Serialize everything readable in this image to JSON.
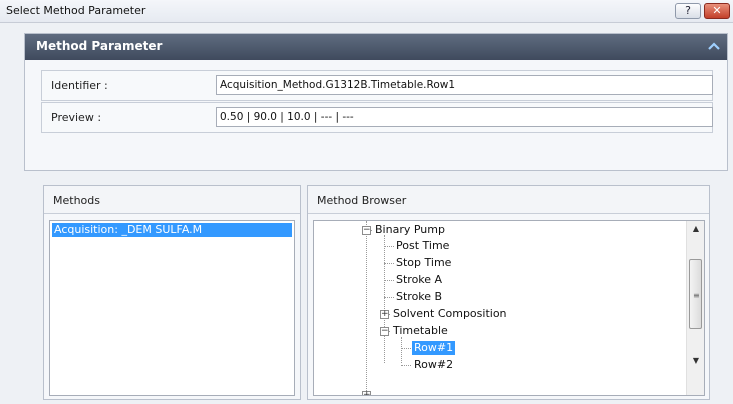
{
  "window": {
    "title": "Select Method Parameter",
    "help_label": "?",
    "close_label": "✕"
  },
  "panel": {
    "title": "Method Parameter",
    "identifier_label": "Identifier :",
    "identifier_value": "Acquisition_Method.G1312B.Timetable.Row1",
    "preview_label": "Preview :",
    "preview_value": "0.50 | 90.0 | 10.0 | --- | ---"
  },
  "methods": {
    "title": "Methods",
    "items": [
      "Acquisition: _DEM SULFA.M"
    ],
    "selected_index": 0
  },
  "browser": {
    "title": "Method Browser",
    "tree": {
      "binary_pump": "Binary Pump",
      "post_time": "Post Time",
      "stop_time": "Stop Time",
      "stroke_a": "Stroke A",
      "stroke_b": "Stroke B",
      "solvent_composition": "Solvent Composition",
      "timetable": "Timetable",
      "row1": "Row#1",
      "row2": "Row#2"
    },
    "selected": "Row#1"
  },
  "colors": {
    "header_bar": "#4b566a",
    "selection": "#3399ff",
    "close_button": "#c2402a"
  }
}
